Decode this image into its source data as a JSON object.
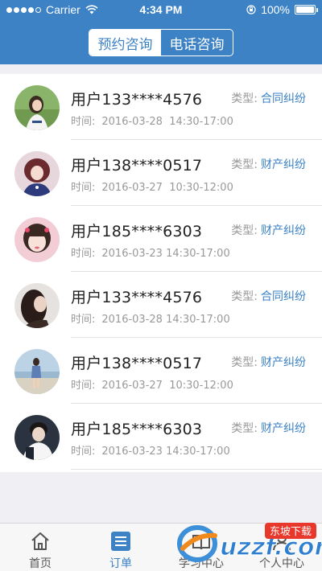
{
  "status_bar": {
    "carrier": "Carrier",
    "time": "4:34 PM",
    "battery": "100%"
  },
  "segment": {
    "items": [
      {
        "label": "预约咨询",
        "active": true
      },
      {
        "label": "电话咨询",
        "active": false
      }
    ]
  },
  "list": {
    "type_key": "类型:",
    "time_key": "时间:",
    "rows": [
      {
        "user": "用户133****4576",
        "type": "合同纠纷",
        "date": "2016-03-28",
        "time": "14:30-17:00"
      },
      {
        "user": "用户138****0517",
        "type": "财产纠纷",
        "date": "2016-03-27",
        "time": "10:30-12:00"
      },
      {
        "user": "用户185****6303",
        "type": "财产纠纷",
        "date": "2016-03-23",
        "time": "14:30-17:00"
      },
      {
        "user": "用户133****4576",
        "type": "合同纠纷",
        "date": "2016-03-28",
        "time": "14:30-17:00"
      },
      {
        "user": "用户138****0517",
        "type": "财产纠纷",
        "date": "2016-03-27",
        "time": "10:30-12:00"
      },
      {
        "user": "用户185****6303",
        "type": "财产纠纷",
        "date": "2016-03-23",
        "time": "14:30-17:00"
      }
    ]
  },
  "tabbar": {
    "items": [
      {
        "label": "首页",
        "icon": "home-icon",
        "active": false
      },
      {
        "label": "订单",
        "icon": "order-list-icon",
        "active": true
      },
      {
        "label": "学习中心",
        "icon": "study-icon",
        "active": false
      },
      {
        "label": "个人中心",
        "icon": "user-icon",
        "active": false
      }
    ]
  },
  "watermark": {
    "text": "uzzf.com",
    "badge": "东坡下载"
  },
  "colors": {
    "brand": "#3d82c5",
    "background": "#efeff4",
    "muted": "#999999"
  }
}
